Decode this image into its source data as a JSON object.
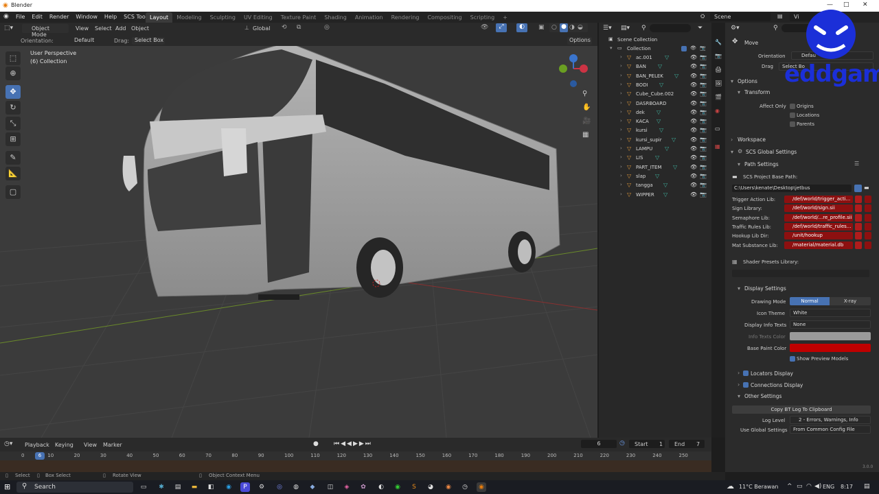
{
  "window_title": "Blender",
  "menu": [
    "File",
    "Edit",
    "Render",
    "Window",
    "Help",
    "SCS Tools"
  ],
  "workspaces": [
    "Layout",
    "Modeling",
    "Sculpting",
    "UV Editing",
    "Texture Paint",
    "Shading",
    "Animation",
    "Rendering",
    "Compositing",
    "Scripting"
  ],
  "scene_label": "Scene",
  "view_layer_label": "Vi",
  "header": {
    "mode": "Object Mode",
    "menus": [
      "View",
      "Select",
      "Add",
      "Object"
    ],
    "orientation_label": "Orientation:",
    "orientation_value": "Default",
    "drag_label": "Drag:",
    "drag_value": "Select Box",
    "transform_space": "Global",
    "options": "Options"
  },
  "viewport": {
    "perspective": "User Perspective",
    "collection": "(6) Collection"
  },
  "outliner": {
    "scene_collection": "Scene Collection",
    "collection": "Collection",
    "items": [
      "ac.001",
      "BAN",
      "BAN_PELEK",
      "BODI",
      "Cube_Cube.002",
      "DASRBOARD",
      "dek",
      "KACA",
      "kursi",
      "kursi_supir",
      "LAMPU",
      "LIS",
      "PART_ITEM",
      "slap",
      "tangga",
      "WIPPER"
    ]
  },
  "properties": {
    "tool_name": "Move",
    "orientation_label": "Orientation",
    "orientation_value": "Defau",
    "drag_label": "Drag",
    "drag_value": "Select Bo",
    "options": "Options",
    "transform": "Transform",
    "affect_only": "Affect Only",
    "origins": "Origins",
    "locations": "Locations",
    "parents": "Parents",
    "workspace": "Workspace",
    "scs_global": "SCS Global Settings",
    "path_settings": "Path Settings",
    "base_path_label": "SCS Project Base Path:",
    "base_path_value": "C:\\Users\\kenate\\Desktop\\jetbus",
    "libs": [
      {
        "label": "Trigger Action Lib:",
        "value": "/def/world/trigger_acti..."
      },
      {
        "label": "Sign Library:",
        "value": "/def/world/sign.sii"
      },
      {
        "label": "Semaphore Lib:",
        "value": "/def/world/...re_profile.sii"
      },
      {
        "label": "Traffic Rules Lib:",
        "value": "/def/world/traffic_rules..."
      },
      {
        "label": "Hookup Lib Dir:",
        "value": "/unit/hookup"
      },
      {
        "label": "Mat Substance Lib:",
        "value": "/material/material.db"
      }
    ],
    "shader_presets": "Shader Presets Library:",
    "display_settings": "Display Settings",
    "drawing_mode_label": "Drawing Mode",
    "drawing_mode_normal": "Normal",
    "drawing_mode_xray": "X-ray",
    "icon_theme_label": "Icon Theme",
    "icon_theme_value": "White",
    "display_info_label": "Display Info Texts",
    "display_info_value": "None",
    "info_color_label": "Info Texts Color",
    "base_paint_label": "Base Paint Color",
    "base_paint_color": "#c00000",
    "show_preview": "Show Preview Models",
    "locators_display": "Locators Display",
    "connections_display": "Connections Display",
    "other_settings": "Other Settings",
    "copy_log": "Copy BT Log To Clipboard",
    "log_level_label": "Log Level",
    "log_level_value": "2 - Errors, Warnings, Info",
    "use_global_label": "Use Global Settings",
    "use_global_value": "From Common Config File"
  },
  "timeline": {
    "menus": [
      "Playback",
      "Keying",
      "View",
      "Marker"
    ],
    "current_frame": "6",
    "start_label": "Start",
    "start_value": "1",
    "end_label": "End",
    "end_value": "7",
    "ticks": [
      "0",
      "10",
      "20",
      "30",
      "40",
      "50",
      "60",
      "70",
      "80",
      "90",
      "100",
      "110",
      "120",
      "130",
      "140",
      "150",
      "160",
      "170",
      "180",
      "190",
      "200",
      "210",
      "220",
      "230",
      "240",
      "250"
    ]
  },
  "statusbar": {
    "select": "Select",
    "box_select": "Box Select",
    "rotate_view": "Rotate View",
    "context_menu": "Object Context Menu",
    "version": "3.0.0"
  },
  "taskbar": {
    "search": "Search",
    "weather": "11°C Berawan",
    "lang": "ENG",
    "time": "8:17"
  },
  "watermark": "eddgame"
}
